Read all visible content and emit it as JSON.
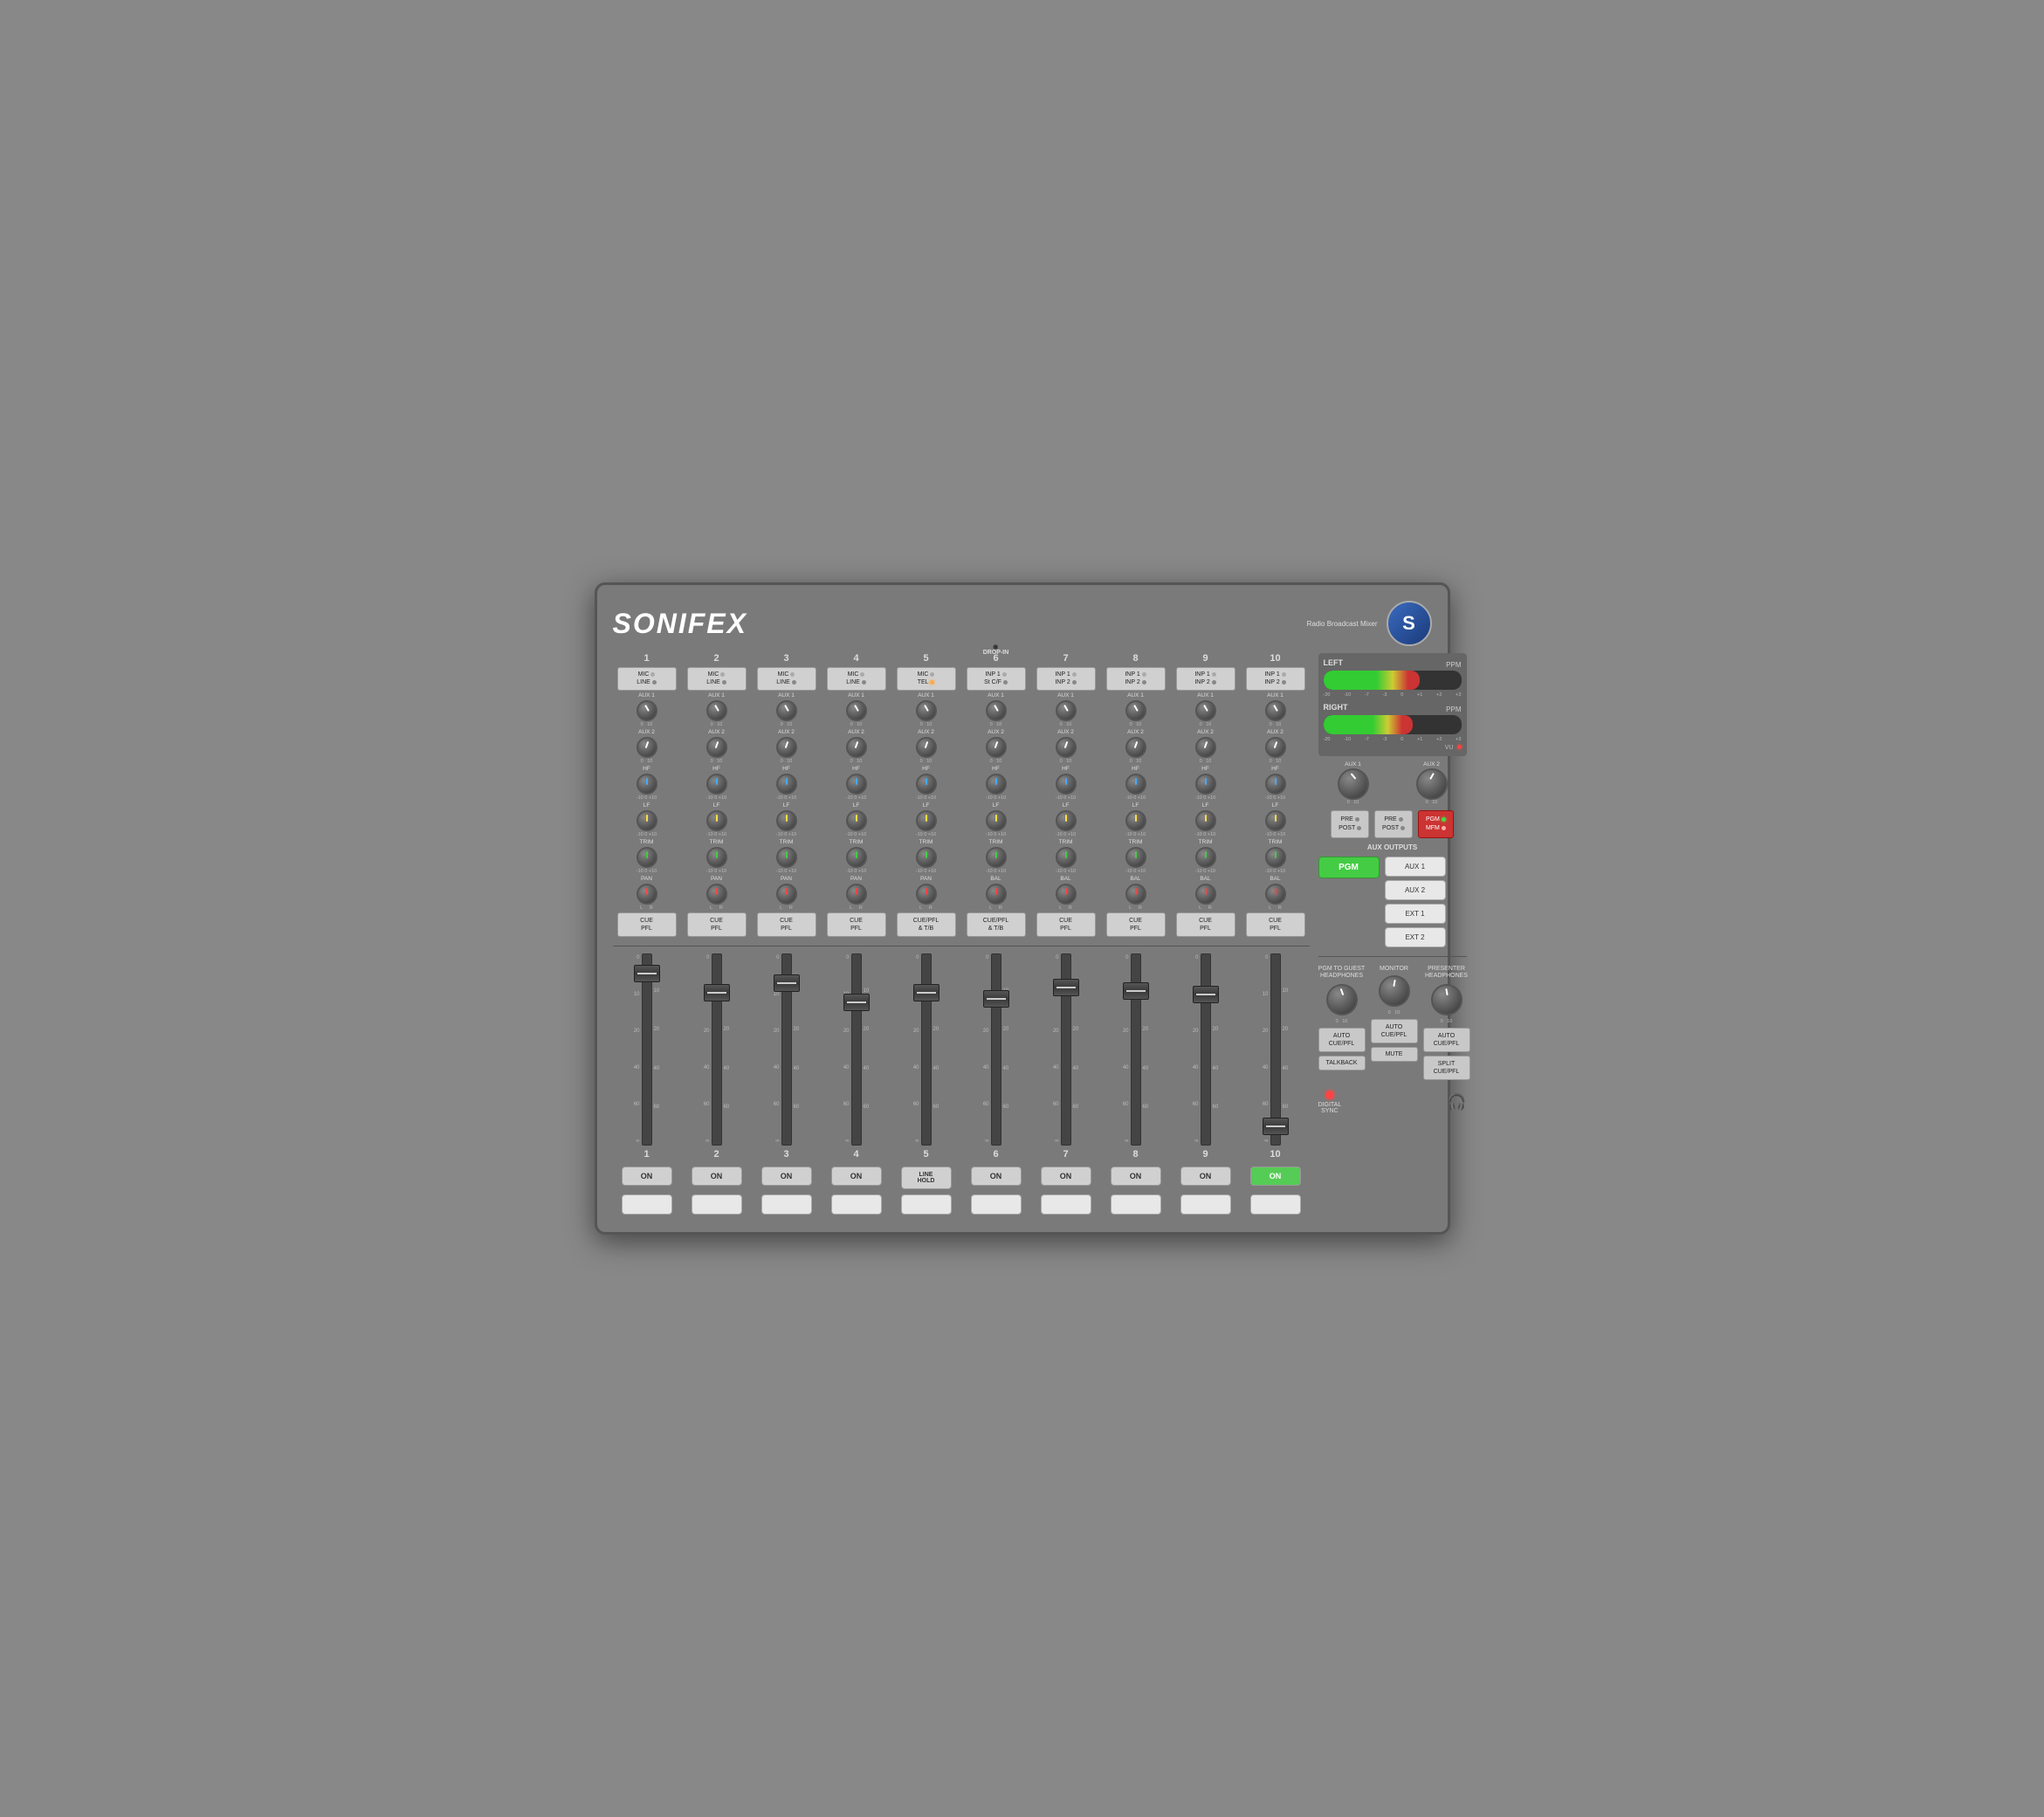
{
  "brand": "SONIFEX",
  "product": "Radio Broadcast Mixer",
  "channels": [
    {
      "num": "1",
      "input": "MIC\nLINE",
      "cue": "CUE\nPFL",
      "on_active": false,
      "input_type": "MIC_LINE"
    },
    {
      "num": "2",
      "input": "MIC\nLINE",
      "cue": "CUE\nPFL",
      "on_active": false,
      "input_type": "MIC_LINE"
    },
    {
      "num": "3",
      "input": "MIC\nLINE",
      "cue": "CUE\nPFL",
      "on_active": false,
      "input_type": "MIC_LINE"
    },
    {
      "num": "4",
      "input": "MIC\nLINE",
      "cue": "CUE\nPFL",
      "on_active": false,
      "input_type": "MIC_LINE"
    },
    {
      "num": "5",
      "input": "MIC\nTEL",
      "cue": "CUE/PFL\n& T/B",
      "on_active": false,
      "on_label": "LINE\nHOLD",
      "input_type": "MIC_TEL"
    },
    {
      "num": "6",
      "input": "INP 1\nSt C/F",
      "cue": "CUE/PFL\n& T/B",
      "on_active": false,
      "input_type": "INP1"
    },
    {
      "num": "7",
      "input": "INP 1\nINP 2",
      "cue": "CUE\nPFL",
      "on_active": false,
      "input_type": "INP1_INP2"
    },
    {
      "num": "8",
      "input": "INP 1\nINP 2",
      "cue": "CUE\nPFL",
      "on_active": false,
      "input_type": "INP1_INP2"
    },
    {
      "num": "9",
      "input": "INP 1\nINP 2",
      "cue": "CUE\nPFL",
      "on_active": false,
      "input_type": "INP1_INP2"
    },
    {
      "num": "10",
      "input": "INP 1\nINP 2",
      "cue": "CUE\nPFL",
      "on_active": true,
      "input_type": "INP1_INP2"
    }
  ],
  "knob_labels": {
    "aux1": "AUX 1",
    "aux2": "AUX 2",
    "hf": "HF",
    "lf": "LF",
    "trim": "TRIM",
    "pan_bal": "PAN",
    "scale_10": "-10  0  +10"
  },
  "fader_scale": [
    "0",
    "10",
    "20",
    "40",
    "60",
    "∞"
  ],
  "right_panel": {
    "vu_left_label": "LEFT",
    "vu_right_label": "RIGHT",
    "ppm_label": "PPM",
    "vu_label": "VU",
    "aux1_label": "AUX 1",
    "aux2_label": "AUX 2",
    "pre_post_label": "PRE O\nPOST O",
    "pgm_mfm_label": "PGM O\nMFM O",
    "aux_outputs_label": "AUX OUTPUTS",
    "pgm_label": "PGM",
    "aux1_out": "AUX 1",
    "aux2_out": "AUX 2",
    "ext1_out": "EXT 1",
    "ext2_out": "EXT 2",
    "pgm_guest_label": "PGM TO GUEST\nHEADPHONES",
    "monitor_label": "MONITOR",
    "presenter_label": "PRESENTER\nHEADPHONES",
    "auto_cue_1": "AUTO\nCUE/PFL",
    "auto_cue_2": "AUTO\nCUE/PFL",
    "auto_cue_3": "AUTO\nCUE/PFL",
    "talkback": "TALKBACK",
    "mute": "MUTE",
    "split_cue": "SPLIT\nCUE/PFL",
    "digital_sync": "DIGITAL\nSYNC"
  }
}
